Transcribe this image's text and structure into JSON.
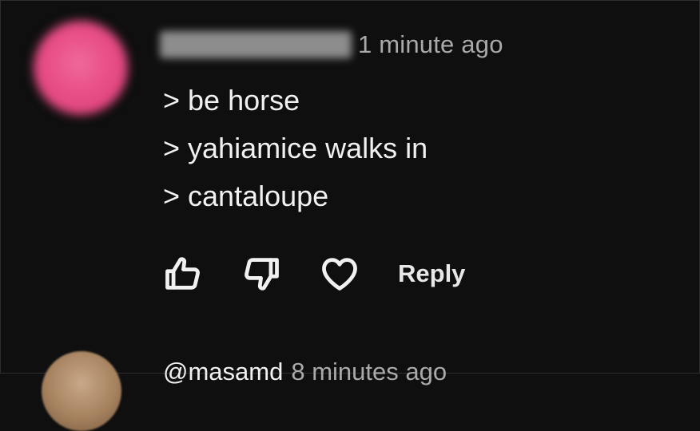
{
  "comment": {
    "timestamp": "1 minute ago",
    "lines": [
      "> be horse",
      "> yahiamice walks in",
      "> cantaloupe"
    ],
    "actions": {
      "like_icon": "thumbs-up-icon",
      "dislike_icon": "thumbs-down-icon",
      "heart_icon": "heart-icon",
      "reply_label": "Reply"
    },
    "avatar_color": "#e84d86"
  },
  "next_comment": {
    "username": "@masamd",
    "timestamp": "8 minutes ago"
  }
}
